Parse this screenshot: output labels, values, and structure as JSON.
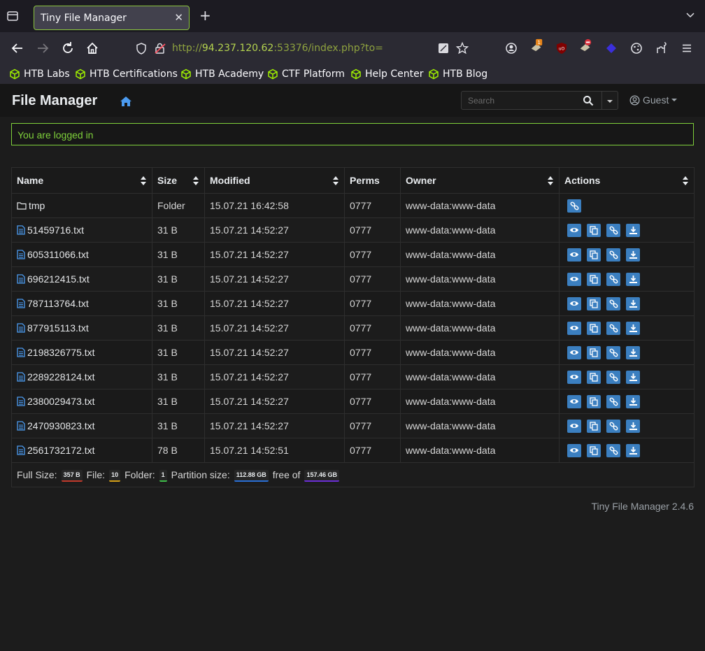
{
  "browser": {
    "tab_title": "Tiny File Manager",
    "url_prefix": "http://",
    "url_host": "94.237.120.62",
    "url_suffix": ":53376/index.php?to="
  },
  "bookmarks": [
    {
      "label": "HTB Labs"
    },
    {
      "label": "HTB Certifications"
    },
    {
      "label": "HTB Academy"
    },
    {
      "label": "CTF Platform"
    },
    {
      "label": "Help Center"
    },
    {
      "label": "HTB Blog"
    }
  ],
  "app": {
    "brand": "File Manager",
    "search_placeholder": "Search",
    "user": "Guest"
  },
  "alert": "You are logged in",
  "table": {
    "headers": [
      "Name",
      "Size",
      "Modified",
      "Perms",
      "Owner",
      "Actions"
    ],
    "rows": [
      {
        "name": "tmp",
        "type": "folder",
        "size": "Folder",
        "modified": "15.07.21 16:42:58",
        "perms": "0777",
        "owner": "www-data:www-data"
      },
      {
        "name": "51459716.txt",
        "type": "file",
        "size": "31 B",
        "modified": "15.07.21 14:52:27",
        "perms": "0777",
        "owner": "www-data:www-data"
      },
      {
        "name": "605311066.txt",
        "type": "file",
        "size": "31 B",
        "modified": "15.07.21 14:52:27",
        "perms": "0777",
        "owner": "www-data:www-data"
      },
      {
        "name": "696212415.txt",
        "type": "file",
        "size": "31 B",
        "modified": "15.07.21 14:52:27",
        "perms": "0777",
        "owner": "www-data:www-data"
      },
      {
        "name": "787113764.txt",
        "type": "file",
        "size": "31 B",
        "modified": "15.07.21 14:52:27",
        "perms": "0777",
        "owner": "www-data:www-data"
      },
      {
        "name": "877915113.txt",
        "type": "file",
        "size": "31 B",
        "modified": "15.07.21 14:52:27",
        "perms": "0777",
        "owner": "www-data:www-data"
      },
      {
        "name": "2198326775.txt",
        "type": "file",
        "size": "31 B",
        "modified": "15.07.21 14:52:27",
        "perms": "0777",
        "owner": "www-data:www-data"
      },
      {
        "name": "2289228124.txt",
        "type": "file",
        "size": "31 B",
        "modified": "15.07.21 14:52:27",
        "perms": "0777",
        "owner": "www-data:www-data"
      },
      {
        "name": "2380029473.txt",
        "type": "file",
        "size": "31 B",
        "modified": "15.07.21 14:52:27",
        "perms": "0777",
        "owner": "www-data:www-data"
      },
      {
        "name": "2470930823.txt",
        "type": "file",
        "size": "31 B",
        "modified": "15.07.21 14:52:27",
        "perms": "0777",
        "owner": "www-data:www-data"
      },
      {
        "name": "2561732172.txt",
        "type": "file",
        "size": "78 B",
        "modified": "15.07.21 14:52:51",
        "perms": "0777",
        "owner": "www-data:www-data"
      }
    ]
  },
  "stats": {
    "full_size_label": "Full Size:",
    "full_size": "357 B",
    "file_label": "File:",
    "file_count": "10",
    "folder_label": "Folder:",
    "folder_count": "1",
    "partition_label": "Partition size:",
    "partition_size": "112.88 GB",
    "free_label": "free of",
    "total_size": "157.46 GB"
  },
  "version": "Tiny File Manager 2.4.6",
  "colors": {
    "accent_green": "#7fd13b",
    "action_blue": "#3b7fc0",
    "link_blue": "#4b9bf0"
  }
}
